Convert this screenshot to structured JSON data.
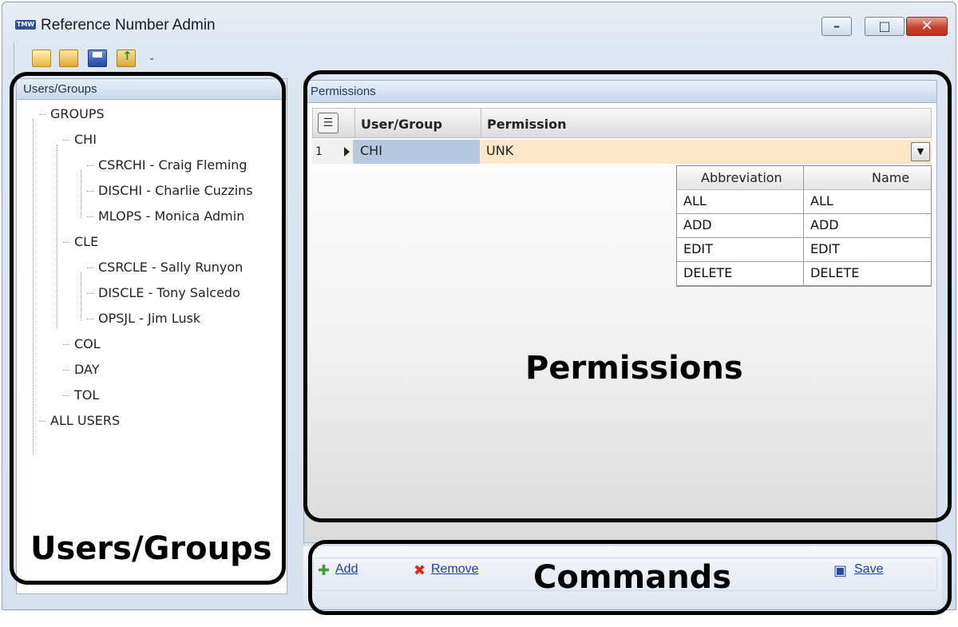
{
  "window": {
    "title": "Reference Number Admin",
    "app_icon_text": "TMW"
  },
  "toolbar": {
    "more_glyph": "⌄"
  },
  "users_groups": {
    "header": "Users/Groups",
    "tree": [
      "GROUPS",
      "CHI",
      "CSRCHI - Craig Fleming",
      "DISCHI - Charlie Cuzzins",
      "MLOPS - Monica Admin",
      "CLE",
      "CSRCLE - Sally Runyon",
      "DISCLE - Tony Salcedo",
      "OPSJL - Jim Lusk",
      "COL",
      "DAY",
      "TOL",
      "ALL USERS"
    ]
  },
  "permissions": {
    "header": "Permissions",
    "columns": [
      "User/Group",
      "Permission"
    ],
    "row": {
      "num": "1",
      "user_group": "CHI",
      "permission": "UNK"
    },
    "dropdown": {
      "headers": [
        "Abbreviation",
        "Name"
      ],
      "rows": [
        [
          "ALL",
          "ALL"
        ],
        [
          "ADD",
          "ADD"
        ],
        [
          "EDIT",
          "EDIT"
        ],
        [
          "DELETE",
          "DELETE"
        ]
      ]
    }
  },
  "commands": {
    "add": "Add",
    "remove": "Remove",
    "save": "Save"
  },
  "annotations": {
    "users_groups": "Users/Groups",
    "permissions": "Permissions",
    "commands": "Commands"
  }
}
